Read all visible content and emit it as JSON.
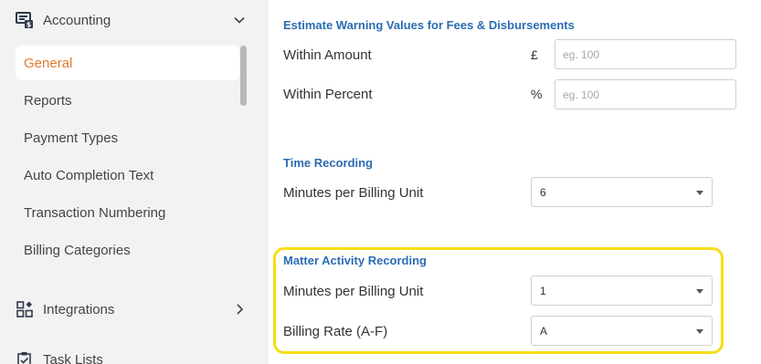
{
  "sidebar": {
    "accounting": {
      "label": "Accounting",
      "icon": "accounting-icon"
    },
    "items": [
      {
        "label": "General",
        "active": true
      },
      {
        "label": "Reports",
        "active": false
      },
      {
        "label": "Payment Types",
        "active": false
      },
      {
        "label": "Auto Completion Text",
        "active": false
      },
      {
        "label": "Transaction Numbering",
        "active": false
      },
      {
        "label": "Billing Categories",
        "active": false
      }
    ],
    "integrations": {
      "label": "Integrations",
      "icon": "integrations-icon"
    },
    "task_lists": {
      "label": "Task Lists",
      "icon": "task-list-icon"
    }
  },
  "main": {
    "estimate": {
      "title": "Estimate Warning Values for Fees & Disbursements",
      "within_amount": {
        "label": "Within Amount",
        "unit": "£",
        "placeholder": "eg. 100",
        "value": ""
      },
      "within_percent": {
        "label": "Within Percent",
        "unit": "%",
        "placeholder": "eg. 100",
        "value": ""
      }
    },
    "time_recording": {
      "title": "Time Recording",
      "minutes_per_unit": {
        "label": "Minutes per Billing Unit",
        "value": "6"
      }
    },
    "matter_activity": {
      "title": "Matter Activity Recording",
      "minutes_per_unit": {
        "label": "Minutes per Billing Unit",
        "value": "1"
      },
      "billing_rate": {
        "label": "Billing Rate (A-F)",
        "value": "A"
      }
    }
  },
  "colors": {
    "accent_blue": "#2b6cb3",
    "active_orange": "#e07a2f",
    "highlight_yellow": "#f5de14"
  }
}
